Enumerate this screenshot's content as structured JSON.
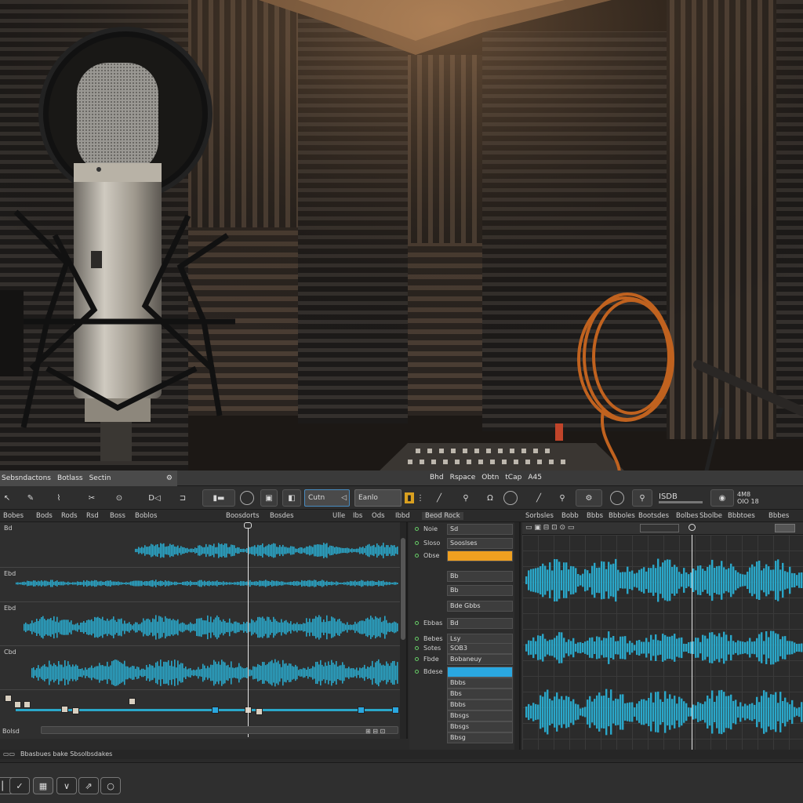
{
  "title_strip": {
    "menus_left": [
      "Sebsndactons",
      "Botlass",
      "Sectin"
    ],
    "menus_right": [
      "Bhd",
      "Rspace",
      "Obtn",
      "tCap",
      "A45"
    ]
  },
  "toolbar": {
    "field1": "Cutn",
    "field2": "Eanlo",
    "icons": [
      "select-tool-icon",
      "pencil-tool-icon",
      "scissors-tool-icon",
      "zoom-icon",
      "text-tool-icon",
      "fade-icon",
      "gain-icon",
      "marker-icon",
      "link-icon",
      "mic-icon",
      "knob-icon"
    ],
    "meter_left": "ISDB",
    "meter_right1": "4M8",
    "meter_right2": "OIO 18"
  },
  "header_row": {
    "arrange_cols": [
      "Bobes",
      "Bods",
      "Rods",
      "Rsd",
      "Boss",
      "Boblos",
      "Boosdorts",
      "Bosdes",
      "Ulle",
      "Ibs",
      "Ods",
      "Ibbd"
    ],
    "inspector_title": "Beod Rock",
    "editor_cols": [
      "Sorbsles",
      "Bobb",
      "Bbbs",
      "Bbboles",
      "Bootsdes",
      "Bolbes",
      "Sbolbe",
      "Bbbtoes",
      "Bbbes"
    ]
  },
  "arrange": {
    "track_labels": [
      "Bd",
      "Ebd",
      "Ebd",
      "Cbd"
    ],
    "footer_left": "Bolsd",
    "footer_status": "Bbasbues bake  Sbsolbsdakes"
  },
  "inspector": {
    "rows": [
      {
        "label": "Noie",
        "value": "Sd"
      },
      {
        "label": "Sloso",
        "value": "Sooslses"
      },
      {
        "label": "Obse",
        "value": "",
        "style": "orange"
      },
      {
        "label": "",
        "value": "Bb"
      },
      {
        "label": "",
        "value": "Bb"
      },
      {
        "label": "",
        "value": "Bde Gbbs"
      },
      {
        "label": "Ebbas",
        "value": "Bd"
      },
      {
        "label": "Bebes",
        "value": "Lsy"
      },
      {
        "label": "Sotes",
        "value": "SOB3"
      },
      {
        "label": "Fbde",
        "value": "Bobaneuy"
      },
      {
        "label": "Bdese",
        "value": "",
        "style": "blue"
      },
      {
        "label": "",
        "value": "Bbbs"
      },
      {
        "label": "",
        "value": "Bbs"
      },
      {
        "label": "",
        "value": "Bbbs"
      },
      {
        "label": "",
        "value": "Bbsgs"
      },
      {
        "label": "",
        "value": "Bbsgs"
      },
      {
        "label": "",
        "value": "Bbsg"
      }
    ]
  },
  "transport": {
    "buttons": [
      "rewind-icon",
      "checkmark-icon",
      "record-icon",
      "down-chevron-icon",
      "tool-icon",
      "loop-icon"
    ]
  },
  "colors": {
    "waveform": "#2aa7c9",
    "accent_orange": "#f0a020",
    "accent_blue": "#2aa7e0"
  }
}
